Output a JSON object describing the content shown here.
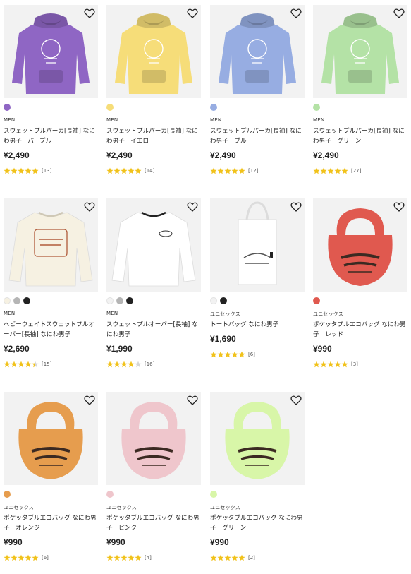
{
  "products": [
    {
      "gender": "MEN",
      "name": "スウェットプルパーカ[長袖] なにわ男子　パープル",
      "price": "¥2,490",
      "rating": 5,
      "reviews": "[13]",
      "kind": "hoodie",
      "color": "#8f66c4",
      "swatches": [
        "#8f66c4"
      ]
    },
    {
      "gender": "MEN",
      "name": "スウェットプルパーカ[長袖] なにわ男子　イエロー",
      "price": "¥2,490",
      "rating": 5,
      "reviews": "[14]",
      "kind": "hoodie",
      "color": "#f6dd79",
      "swatches": [
        "#f6dd79"
      ]
    },
    {
      "gender": "MEN",
      "name": "スウェットプルパーカ[長袖] なにわ男子　ブルー",
      "price": "¥2,490",
      "rating": 5,
      "reviews": "[12]",
      "kind": "hoodie",
      "color": "#97ade2",
      "swatches": [
        "#97ade2"
      ]
    },
    {
      "gender": "MEN",
      "name": "スウェットプルパーカ[長袖] なにわ男子　グリーン",
      "price": "¥2,490",
      "rating": 5,
      "reviews": "[27]",
      "kind": "hoodie",
      "color": "#b4e2a6",
      "swatches": [
        "#b4e2a6"
      ]
    },
    {
      "gender": "MEN",
      "name": "ヘビーウェイトスウェットプルオーバー[長袖] なにわ男子",
      "price": "¥2,690",
      "rating": 4.5,
      "reviews": "[15]",
      "kind": "sweat",
      "color": "#f6f1e2",
      "swatches": [
        "#f6f1e2",
        "#b5b5b5",
        "#222222"
      ]
    },
    {
      "gender": "MEN",
      "name": "スウェットプルオーバー[長袖] なにわ男子",
      "price": "¥1,990",
      "rating": 4,
      "reviews": "[16]",
      "kind": "sweat2",
      "color": "#ffffff",
      "swatches": [
        "#f2f2f2",
        "#b5b5b5",
        "#222222"
      ]
    },
    {
      "gender": "ユニセックス",
      "name": "トートバッグ なにわ男子",
      "price": "¥1,690",
      "rating": 5,
      "reviews": "[6]",
      "kind": "tote",
      "color": "#ffffff",
      "swatches": [
        "#f2f2f2",
        "#222222"
      ]
    },
    {
      "gender": "ユニセックス",
      "name": "ポケッタブルエコバッグ なにわ男子　レッド",
      "price": "¥990",
      "rating": 5,
      "reviews": "[3]",
      "kind": "eco",
      "color": "#e0594f",
      "swatches": [
        "#e0594f"
      ]
    },
    {
      "gender": "ユニセックス",
      "name": "ポケッタブルエコバッグ なにわ男子　オレンジ",
      "price": "¥990",
      "rating": 5,
      "reviews": "[6]",
      "kind": "eco",
      "color": "#e69d4e",
      "swatches": [
        "#e69d4e"
      ]
    },
    {
      "gender": "ユニセックス",
      "name": "ポケッタブルエコバッグ なにわ男子　ピンク",
      "price": "¥990",
      "rating": 5,
      "reviews": "[4]",
      "kind": "eco",
      "color": "#efc6cc",
      "swatches": [
        "#efc6cc"
      ]
    },
    {
      "gender": "ユニセックス",
      "name": "ポケッタブルエコバッグ なにわ男子　グリーン",
      "price": "¥990",
      "rating": 5,
      "reviews": "[2]",
      "kind": "eco",
      "color": "#d8f6a8",
      "swatches": [
        "#d8f6a8"
      ]
    }
  ],
  "colors": {
    "star": "#f1c21b",
    "star_empty": "#d6d6d6",
    "accent": "#222222"
  }
}
